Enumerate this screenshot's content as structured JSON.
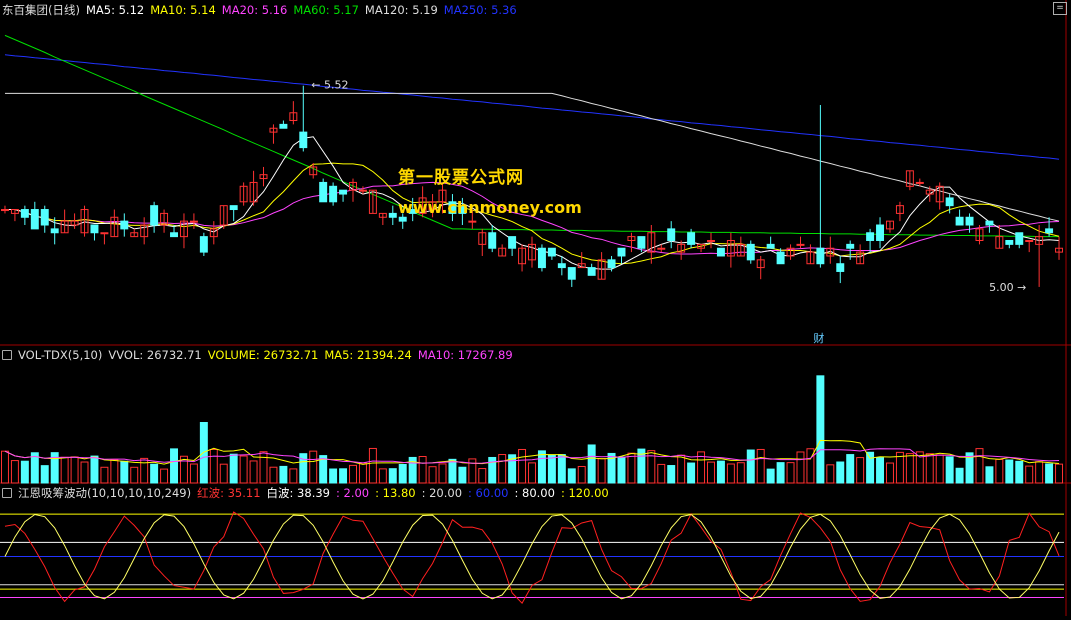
{
  "header": {
    "stock": "东百集团(日线)",
    "ma": [
      {
        "label": "MA5: 5.12",
        "color": "#ffffff"
      },
      {
        "label": "MA10: 5.14",
        "color": "#ffff00"
      },
      {
        "label": "MA20: 5.16",
        "color": "#ff44ff"
      },
      {
        "label": "MA60: 5.17",
        "color": "#00e000"
      },
      {
        "label": "MA120: 5.19",
        "color": "#dddddd"
      },
      {
        "label": "MA250: 5.36",
        "color": "#2233ff"
      }
    ]
  },
  "vol_header": {
    "items": [
      {
        "label": "VOL-TDX(5,10)",
        "color": "#dddddd"
      },
      {
        "label": "VVOL: 26732.71",
        "color": "#dddddd"
      },
      {
        "label": "VOLUME: 26732.71",
        "color": "#ffff00"
      },
      {
        "label": "MA5: 21394.24",
        "color": "#ffff00"
      },
      {
        "label": "MA10: 17267.89",
        "color": "#ff44ff"
      }
    ]
  },
  "ind_header": {
    "items": [
      {
        "label": "江恩吸筹波动(10,10,10,10,249)",
        "color": "#dddddd"
      },
      {
        "label": "红波: 35.11",
        "color": "#ff3333"
      },
      {
        "label": "白波: 38.39",
        "color": "#ffffff"
      },
      {
        "label": ": 2.00",
        "color": "#ff44ff"
      },
      {
        "label": ": 13.80",
        "color": "#ffff00"
      },
      {
        "label": ": 20.00",
        "color": "#dddddd"
      },
      {
        "label": ": 60.00",
        "color": "#2233ff"
      },
      {
        "label": ": 80.00",
        "color": "#ffffff"
      },
      {
        "label": ": 120.00",
        "color": "#ffff00"
      }
    ]
  },
  "watermark": {
    "line1": "第一股票公式网",
    "line2": "www.chnmoney.com"
  },
  "colors": {
    "up": "#ff3232",
    "down": "#54ffff",
    "bg": "#000000",
    "frame": "#a00000"
  },
  "chart_data": {
    "type": "candlestick",
    "price_ylim": [
      4.85,
      5.7
    ],
    "high_label": "5.52",
    "low_label": "5.00",
    "event_marker": "财",
    "candles": [],
    "ma_lines": {},
    "volume_ylim": [
      0,
      70000
    ],
    "volume": [],
    "indicator": {
      "ylim": [
        -10,
        140
      ],
      "levels": [
        2,
        13.8,
        20,
        60,
        80,
        120
      ],
      "red_wave": [],
      "white_wave": []
    }
  }
}
